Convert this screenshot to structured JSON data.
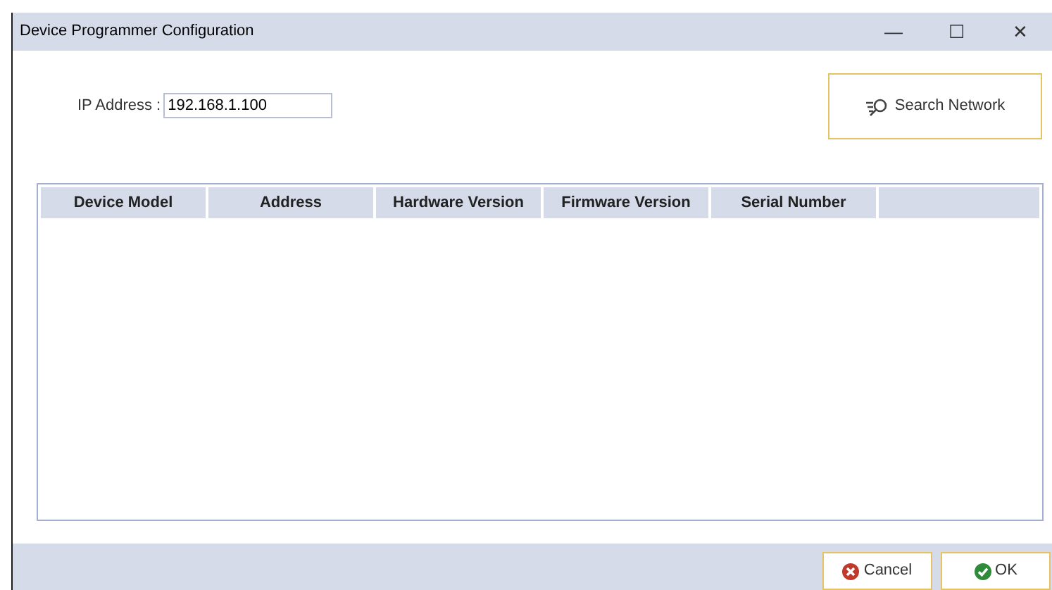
{
  "window": {
    "title": "Device Programmer Configuration",
    "controls": [
      "—",
      "☐",
      "✕"
    ]
  },
  "ip_address": {
    "label": "IP Address :",
    "value": "192.168.1.100"
  },
  "search_button": {
    "label": "Search Network"
  },
  "table": {
    "columns": [
      "Device Model",
      "Address",
      "Hardware Version",
      "Firmware Version",
      "Serial Number"
    ]
  },
  "buttons": [
    {
      "kind": "cancel",
      "label": "Cancel"
    },
    {
      "kind": "ok",
      "label": "OK"
    }
  ]
}
